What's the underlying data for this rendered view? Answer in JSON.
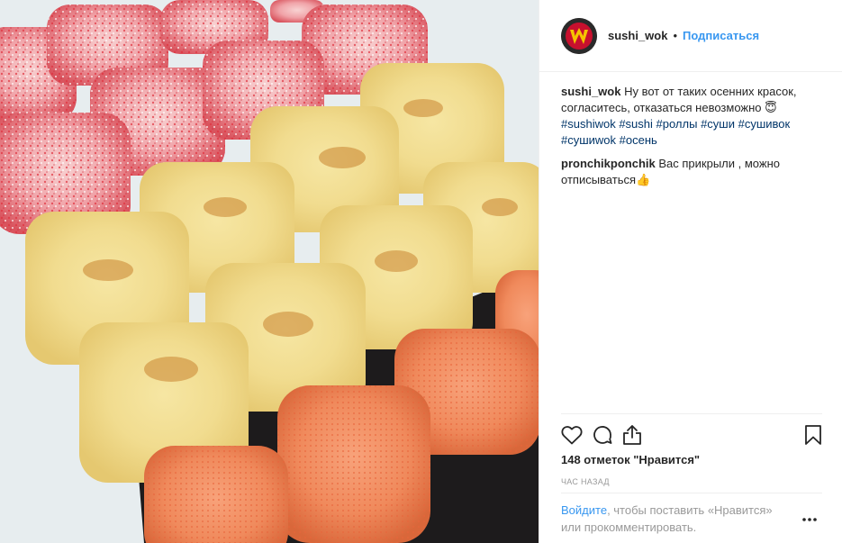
{
  "header": {
    "username": "sushi_wok",
    "separator": "•",
    "follow_label": "Подписаться",
    "avatar_icon": "sushi-wok-logo-icon"
  },
  "caption": {
    "username": "sushi_wok",
    "text": "Ну вот от таких осенних красок, согласитесь, отказаться невозможно",
    "emoji": "😇",
    "hashtags_line1": [
      "#sushiwok",
      "#sushi",
      "#роллы",
      "#суши",
      "#сушивок"
    ],
    "hashtags_line2": [
      "#сушиwok",
      "#осень"
    ]
  },
  "comments": [
    {
      "username": "pronchikponchik",
      "text": "Вас прикрыли , можно отписываться",
      "emoji": "👍"
    }
  ],
  "actions": {
    "like_icon": "heart-icon",
    "comment_icon": "comment-icon",
    "share_icon": "share-icon",
    "save_icon": "bookmark-icon"
  },
  "likes_text": "148 отметок \"Нравится\"",
  "timestamp": "ЧАС НАЗАД",
  "login_prompt": {
    "link": "Войдите",
    "text": ", чтобы поставить «Нравится» или прокомментировать.",
    "more_icon": "more-options-icon"
  },
  "colors": {
    "link_blue": "#3897f0",
    "hashtag": "#003569",
    "muted": "#999999"
  }
}
